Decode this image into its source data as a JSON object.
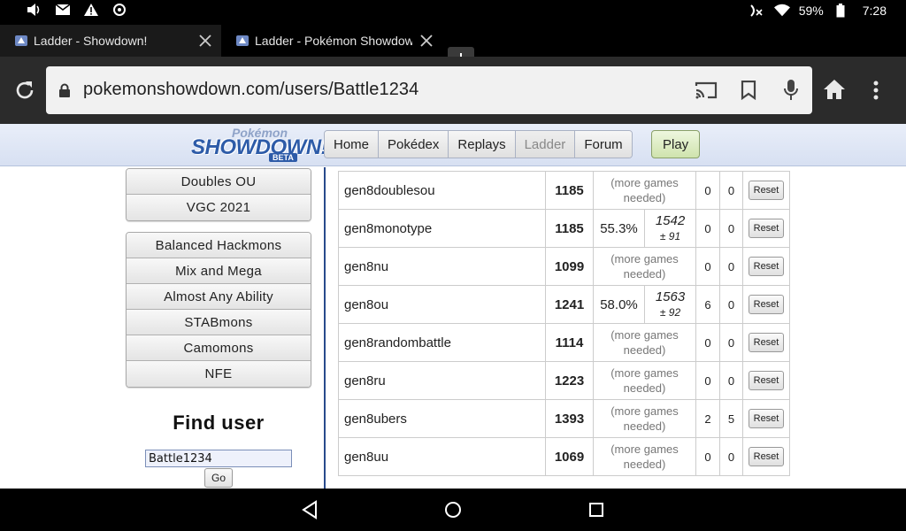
{
  "status_bar": {
    "battery": "59%",
    "time": "7:28",
    "icons": [
      "volume-icon",
      "mail-icon",
      "warning-icon",
      "sync-icon",
      "no-signal-icon",
      "wifi-icon",
      "battery-icon"
    ]
  },
  "tabs": [
    {
      "label": "Ladder - Showdown!"
    },
    {
      "label": "Ladder - Pokémon Showdown"
    }
  ],
  "address_bar": {
    "url": "pokemonshowdown.com/users/Battle1234"
  },
  "site": {
    "logo_top": "Pokémon",
    "logo_main": "SHOWDOWN!",
    "logo_badge": "BETA",
    "nav": [
      "Home",
      "Pokédex",
      "Replays",
      "Ladder",
      "Forum"
    ],
    "play": "Play"
  },
  "sidebar": {
    "group1": [
      "Doubles OU",
      "VGC 2021"
    ],
    "group2": [
      "Balanced Hackmons",
      "Mix and Mega",
      "Almost Any Ability",
      "STABmons",
      "Camomons",
      "NFE"
    ],
    "find_title": "Find user",
    "find_value": "Battle1234",
    "go": "Go"
  },
  "ladder": {
    "more_games": "(more games needed)",
    "reset": "Reset",
    "rows": [
      {
        "format": "gen8doublesou",
        "elo": "1185",
        "w": "0",
        "l": "0"
      },
      {
        "format": "gen8monotype",
        "elo": "1185",
        "gxe": "55.3%",
        "glicko": "1542",
        "dev": "± 91",
        "w": "0",
        "l": "0"
      },
      {
        "format": "gen8nu",
        "elo": "1099",
        "w": "0",
        "l": "0"
      },
      {
        "format": "gen8ou",
        "elo": "1241",
        "gxe": "58.0%",
        "glicko": "1563",
        "dev": "± 92",
        "w": "6",
        "l": "0"
      },
      {
        "format": "gen8randombattle",
        "elo": "1114",
        "w": "0",
        "l": "0"
      },
      {
        "format": "gen8ru",
        "elo": "1223",
        "w": "0",
        "l": "0"
      },
      {
        "format": "gen8ubers",
        "elo": "1393",
        "w": "2",
        "l": "5"
      },
      {
        "format": "gen8uu",
        "elo": "1069",
        "w": "0",
        "l": "0"
      }
    ]
  }
}
